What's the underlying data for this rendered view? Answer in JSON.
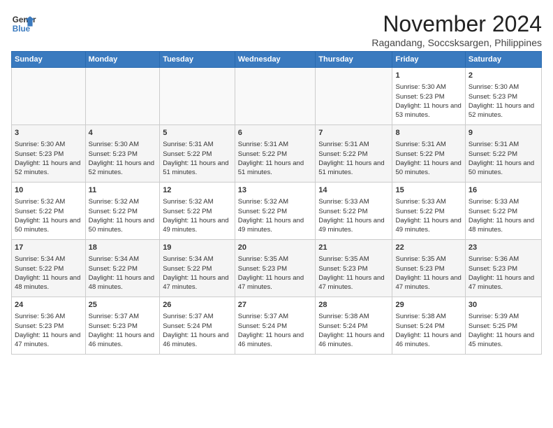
{
  "header": {
    "logo_line1": "General",
    "logo_line2": "Blue",
    "month": "November 2024",
    "location": "Ragandang, Soccsksargen, Philippines"
  },
  "weekdays": [
    "Sunday",
    "Monday",
    "Tuesday",
    "Wednesday",
    "Thursday",
    "Friday",
    "Saturday"
  ],
  "weeks": [
    [
      {
        "day": "",
        "info": ""
      },
      {
        "day": "",
        "info": ""
      },
      {
        "day": "",
        "info": ""
      },
      {
        "day": "",
        "info": ""
      },
      {
        "day": "",
        "info": ""
      },
      {
        "day": "1",
        "info": "Sunrise: 5:30 AM\nSunset: 5:23 PM\nDaylight: 11 hours and 53 minutes."
      },
      {
        "day": "2",
        "info": "Sunrise: 5:30 AM\nSunset: 5:23 PM\nDaylight: 11 hours and 52 minutes."
      }
    ],
    [
      {
        "day": "3",
        "info": "Sunrise: 5:30 AM\nSunset: 5:23 PM\nDaylight: 11 hours and 52 minutes."
      },
      {
        "day": "4",
        "info": "Sunrise: 5:30 AM\nSunset: 5:23 PM\nDaylight: 11 hours and 52 minutes."
      },
      {
        "day": "5",
        "info": "Sunrise: 5:31 AM\nSunset: 5:22 PM\nDaylight: 11 hours and 51 minutes."
      },
      {
        "day": "6",
        "info": "Sunrise: 5:31 AM\nSunset: 5:22 PM\nDaylight: 11 hours and 51 minutes."
      },
      {
        "day": "7",
        "info": "Sunrise: 5:31 AM\nSunset: 5:22 PM\nDaylight: 11 hours and 51 minutes."
      },
      {
        "day": "8",
        "info": "Sunrise: 5:31 AM\nSunset: 5:22 PM\nDaylight: 11 hours and 50 minutes."
      },
      {
        "day": "9",
        "info": "Sunrise: 5:31 AM\nSunset: 5:22 PM\nDaylight: 11 hours and 50 minutes."
      }
    ],
    [
      {
        "day": "10",
        "info": "Sunrise: 5:32 AM\nSunset: 5:22 PM\nDaylight: 11 hours and 50 minutes."
      },
      {
        "day": "11",
        "info": "Sunrise: 5:32 AM\nSunset: 5:22 PM\nDaylight: 11 hours and 50 minutes."
      },
      {
        "day": "12",
        "info": "Sunrise: 5:32 AM\nSunset: 5:22 PM\nDaylight: 11 hours and 49 minutes."
      },
      {
        "day": "13",
        "info": "Sunrise: 5:32 AM\nSunset: 5:22 PM\nDaylight: 11 hours and 49 minutes."
      },
      {
        "day": "14",
        "info": "Sunrise: 5:33 AM\nSunset: 5:22 PM\nDaylight: 11 hours and 49 minutes."
      },
      {
        "day": "15",
        "info": "Sunrise: 5:33 AM\nSunset: 5:22 PM\nDaylight: 11 hours and 49 minutes."
      },
      {
        "day": "16",
        "info": "Sunrise: 5:33 AM\nSunset: 5:22 PM\nDaylight: 11 hours and 48 minutes."
      }
    ],
    [
      {
        "day": "17",
        "info": "Sunrise: 5:34 AM\nSunset: 5:22 PM\nDaylight: 11 hours and 48 minutes."
      },
      {
        "day": "18",
        "info": "Sunrise: 5:34 AM\nSunset: 5:22 PM\nDaylight: 11 hours and 48 minutes."
      },
      {
        "day": "19",
        "info": "Sunrise: 5:34 AM\nSunset: 5:22 PM\nDaylight: 11 hours and 47 minutes."
      },
      {
        "day": "20",
        "info": "Sunrise: 5:35 AM\nSunset: 5:23 PM\nDaylight: 11 hours and 47 minutes."
      },
      {
        "day": "21",
        "info": "Sunrise: 5:35 AM\nSunset: 5:23 PM\nDaylight: 11 hours and 47 minutes."
      },
      {
        "day": "22",
        "info": "Sunrise: 5:35 AM\nSunset: 5:23 PM\nDaylight: 11 hours and 47 minutes."
      },
      {
        "day": "23",
        "info": "Sunrise: 5:36 AM\nSunset: 5:23 PM\nDaylight: 11 hours and 47 minutes."
      }
    ],
    [
      {
        "day": "24",
        "info": "Sunrise: 5:36 AM\nSunset: 5:23 PM\nDaylight: 11 hours and 47 minutes."
      },
      {
        "day": "25",
        "info": "Sunrise: 5:37 AM\nSunset: 5:23 PM\nDaylight: 11 hours and 46 minutes."
      },
      {
        "day": "26",
        "info": "Sunrise: 5:37 AM\nSunset: 5:24 PM\nDaylight: 11 hours and 46 minutes."
      },
      {
        "day": "27",
        "info": "Sunrise: 5:37 AM\nSunset: 5:24 PM\nDaylight: 11 hours and 46 minutes."
      },
      {
        "day": "28",
        "info": "Sunrise: 5:38 AM\nSunset: 5:24 PM\nDaylight: 11 hours and 46 minutes."
      },
      {
        "day": "29",
        "info": "Sunrise: 5:38 AM\nSunset: 5:24 PM\nDaylight: 11 hours and 46 minutes."
      },
      {
        "day": "30",
        "info": "Sunrise: 5:39 AM\nSunset: 5:25 PM\nDaylight: 11 hours and 45 minutes."
      }
    ]
  ]
}
